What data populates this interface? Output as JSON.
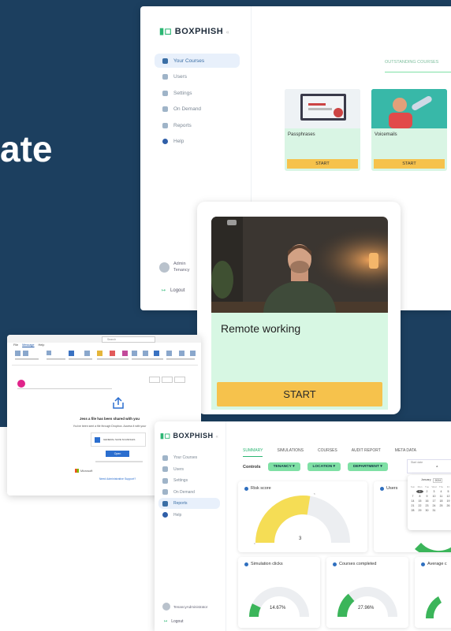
{
  "hero": {
    "word": "ate"
  },
  "top_app": {
    "logo": "BOXPHISH",
    "nav": [
      {
        "label": "Your Courses",
        "active": true
      },
      {
        "label": "Users"
      },
      {
        "label": "Settings"
      },
      {
        "label": "On Demand"
      },
      {
        "label": "Reports"
      },
      {
        "label": "Help"
      }
    ],
    "user_name": "Admin",
    "user_org": "Tenancy",
    "logout": "Logout",
    "tab_label": "OUTSTANDING COURSES",
    "courses": [
      {
        "title": "Passphrases",
        "start": "START"
      },
      {
        "title": "Voicemails",
        "start": "START"
      }
    ]
  },
  "video_card": {
    "title": "Remote working",
    "start": "START"
  },
  "outlook": {
    "search": "Search",
    "menu": [
      "File",
      "Message",
      "Help"
    ],
    "heading": "Jess a file has been shared with you",
    "body": "You've been sent a file through Dropbox. Access it with your",
    "file_label": "GENERAL SAVE SCANFILES",
    "open_btn": "Open",
    "brand": "Microsoft",
    "footer_link": "Need Administrative Support?"
  },
  "dashboard": {
    "logo": "BOXPHISH",
    "nav": [
      {
        "label": "Your Courses"
      },
      {
        "label": "Users"
      },
      {
        "label": "Settings"
      },
      {
        "label": "On Demand"
      },
      {
        "label": "Reports",
        "active": true
      },
      {
        "label": "Help"
      }
    ],
    "user": "TenancyAdministrator",
    "logout": "Logout",
    "tabs": [
      "SUMMARY",
      "SIMULATIONS",
      "COURSES",
      "AUDIT REPORT",
      "META DATA"
    ],
    "controls_label": "Controls",
    "filters": [
      "TENANCY",
      "LOCATION",
      "DEPARTMENT"
    ],
    "date_label": "Start date",
    "calendar": {
      "month": "January",
      "year": "2024",
      "days": [
        "Sun",
        "Mon",
        "Tue",
        "Wed",
        "Thu",
        "Fri"
      ],
      "rows": [
        [
          "",
          "1",
          "2",
          "3",
          "4",
          "5"
        ],
        [
          "7",
          "8",
          "9",
          "10",
          "11",
          "12"
        ],
        [
          "14",
          "15",
          "16",
          "17",
          "18",
          "19"
        ],
        [
          "21",
          "22",
          "23",
          "24",
          "25",
          "26"
        ],
        [
          "28",
          "29",
          "30",
          "31",
          "",
          ""
        ]
      ]
    },
    "panes": {
      "risk": {
        "title": "Risk score",
        "value": "3",
        "min": "0",
        "max": "5",
        "level": 0.55,
        "color": "#f5dd55"
      },
      "users": {
        "title": "Users"
      },
      "sim": {
        "title": "Simulation clicks",
        "value": "14.67%",
        "level": 0.1467,
        "color": "#3bb55a"
      },
      "courses": {
        "title": "Courses completed",
        "value": "27.96%",
        "level": 0.2796,
        "color": "#3bb55a"
      },
      "avg": {
        "title": "Average c"
      }
    }
  }
}
